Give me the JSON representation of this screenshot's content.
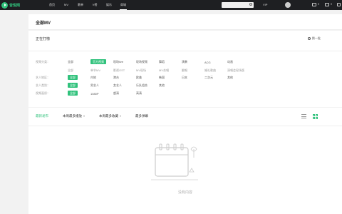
{
  "app": {
    "name": "音悦网"
  },
  "topnav": {
    "items": [
      "首页",
      "MV",
      "歌单",
      "V榜",
      "娱乐",
      "商城"
    ],
    "active_index": 5
  },
  "header_right": {
    "vip": "VIP"
  },
  "page": {
    "title": "全部MV"
  },
  "filter": {
    "hot_label": "正在打榜",
    "refresh_label": "换一批",
    "rows": [
      {
        "label": "视频分类：",
        "options": [
          "全部",
          "官方视频",
          "现场live",
          "现场视频",
          "舞蹈",
          "演奏",
          "ACG",
          "动画"
        ],
        "selected": 1,
        "style": "main"
      },
      {
        "label": "",
        "options": [
          "全部",
          "单节MV",
          "影视OST",
          "MV现场",
          "MV合唱",
          "翻唱",
          "婚礼歌曲",
          "演唱会现场版"
        ],
        "selected": -1,
        "style": "sub"
      },
      {
        "label": "艺人地区：",
        "options": [
          "全部",
          "内地",
          "港台",
          "欧美",
          "韩国",
          "日本",
          "二次元",
          "其他"
        ],
        "selected": 0,
        "style": "main"
      },
      {
        "label": "艺人类别：",
        "options": [
          "全部",
          "男艺人",
          "女艺人",
          "乐队组合",
          "其他"
        ],
        "selected": 0,
        "style": "main"
      },
      {
        "label": "视频画质：",
        "options": [
          "全部",
          "1080P",
          "超清",
          "高清"
        ],
        "selected": 0,
        "style": "main"
      }
    ]
  },
  "content": {
    "tabs": [
      {
        "label": "最新发布",
        "caret": false,
        "active": true
      },
      {
        "label": "本周最多播放",
        "caret": true,
        "active": false
      },
      {
        "label": "本周最多收藏",
        "caret": true,
        "active": false
      },
      {
        "label": "最多弹幕",
        "caret": false,
        "active": false
      }
    ],
    "empty_text": "没有内容",
    "accent": "#31c27c"
  }
}
